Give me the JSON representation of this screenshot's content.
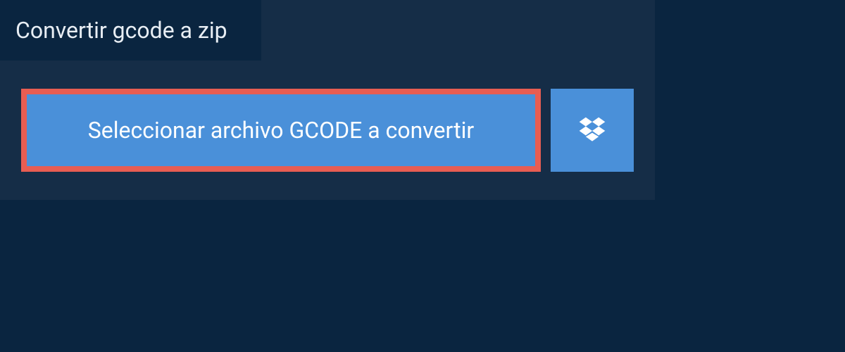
{
  "header": {
    "title": "Convertir gcode a zip"
  },
  "upload": {
    "select_file_label": "Seleccionar archivo GCODE a convertir"
  },
  "colors": {
    "bg_dark": "#0a2540",
    "bg_panel": "#152d47",
    "button_blue": "#4a90d9",
    "highlight_border": "#e85d52"
  }
}
